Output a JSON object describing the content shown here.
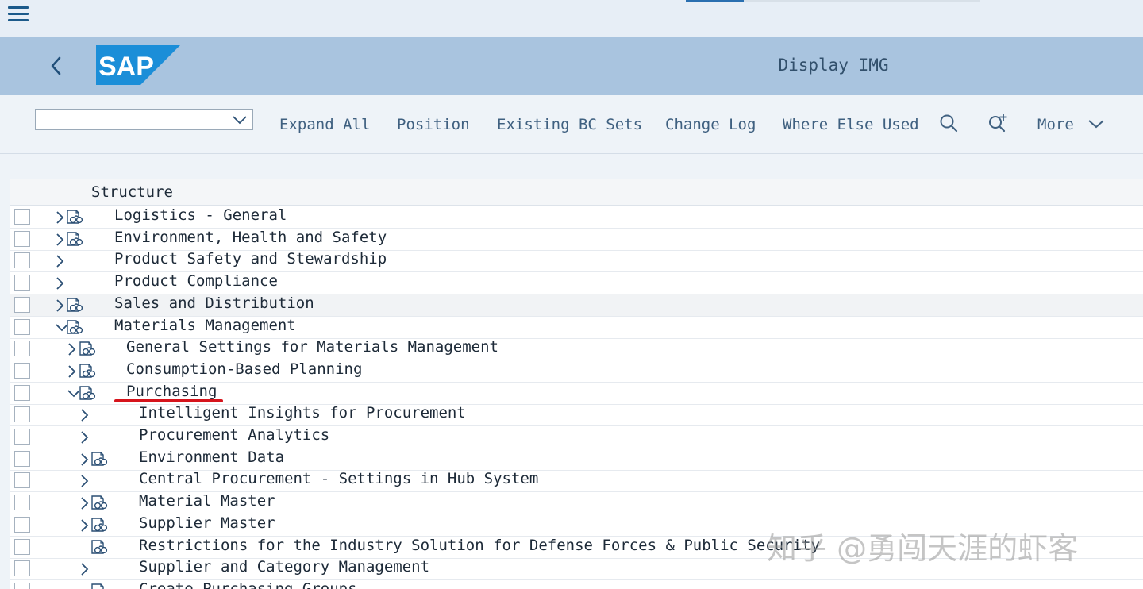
{
  "shell": {
    "title": "Display IMG",
    "brand": "SAP"
  },
  "toolbar": {
    "combo_value": "",
    "buttons": [
      "Expand All",
      "Position",
      "Existing BC Sets",
      "Change Log",
      "Where Else Used"
    ],
    "more_label": "More"
  },
  "tree": {
    "column_header": "Structure",
    "rows": [
      {
        "label": "Logistics - General",
        "level": 0,
        "state": "collapsed",
        "icon": "img-activity-icon"
      },
      {
        "label": "Environment, Health and Safety",
        "level": 0,
        "state": "collapsed",
        "icon": "img-activity-icon"
      },
      {
        "label": "Product Safety and Stewardship",
        "level": 0,
        "state": "collapsed",
        "icon": ""
      },
      {
        "label": "Product Compliance",
        "level": 0,
        "state": "collapsed",
        "icon": ""
      },
      {
        "label": "Sales and Distribution",
        "level": 0,
        "state": "collapsed",
        "icon": "img-activity-icon"
      },
      {
        "label": "Materials Management",
        "level": 0,
        "state": "expanded",
        "icon": "img-activity-icon"
      },
      {
        "label": "General Settings for Materials Management",
        "level": 1,
        "state": "collapsed",
        "icon": "img-activity-icon"
      },
      {
        "label": "Consumption-Based Planning",
        "level": 1,
        "state": "collapsed",
        "icon": "img-activity-icon"
      },
      {
        "label": "Purchasing",
        "level": 1,
        "state": "expanded",
        "icon": "img-activity-icon"
      },
      {
        "label": "Intelligent Insights for Procurement",
        "level": 2,
        "state": "collapsed",
        "icon": ""
      },
      {
        "label": "Procurement Analytics",
        "level": 2,
        "state": "collapsed",
        "icon": ""
      },
      {
        "label": "Environment Data",
        "level": 2,
        "state": "collapsed",
        "icon": "img-activity-icon"
      },
      {
        "label": "Central Procurement - Settings in Hub System",
        "level": 2,
        "state": "collapsed",
        "icon": ""
      },
      {
        "label": "Material Master",
        "level": 2,
        "state": "collapsed",
        "icon": "img-activity-icon"
      },
      {
        "label": "Supplier Master",
        "level": 2,
        "state": "collapsed",
        "icon": "img-activity-icon"
      },
      {
        "label": "Restrictions for the Industry Solution for Defense Forces & Public Security",
        "level": 2,
        "state": "leaf",
        "icon": "img-activity-icon"
      },
      {
        "label": "Supplier and Category Management",
        "level": 2,
        "state": "collapsed",
        "icon": ""
      },
      {
        "label": "Create Purchasing Groups",
        "level": 2,
        "state": "leaf",
        "icon": "img-activity-icon"
      }
    ]
  },
  "watermark": "知乎 @勇闯天涯的虾客",
  "colors": {
    "shell_bg": "#a9c4df",
    "page_bg": "#eef3f8",
    "link_text": "#3f6080",
    "highlight_underline": "#d6141c",
    "sap_blue": "#1b8ed8"
  }
}
